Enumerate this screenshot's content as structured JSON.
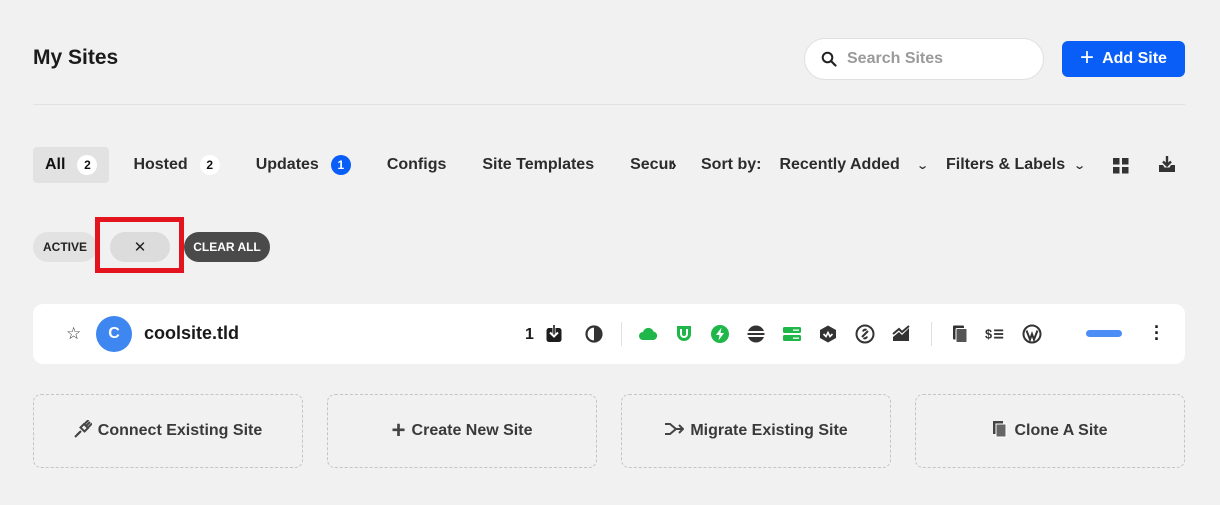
{
  "header": {
    "title": "My Sites",
    "search_placeholder": "Search Sites",
    "add_site_label": "Add Site",
    "add_site_icon": "plus-icon"
  },
  "tabs": [
    {
      "label": "All",
      "count": "2",
      "active": true
    },
    {
      "label": "Hosted",
      "count": "2"
    },
    {
      "label": "Updates",
      "count": "1",
      "badge_color": "#0a5ef8"
    },
    {
      "label": "Configs"
    },
    {
      "label": "Site Templates"
    },
    {
      "label": "Securi"
    }
  ],
  "toolbar": {
    "sort_label": "Sort by:",
    "sort_value": "Recently Added",
    "filters_label": "Filters & Labels"
  },
  "chips": {
    "active_label": "ACTIVE",
    "remove_symbol": "✕",
    "clear_all_label": "CLEAR ALL"
  },
  "sites": [
    {
      "avatar_letter": "C",
      "name": "coolsite.tld",
      "updates_count": "1",
      "progress_color": "#4c8ef5",
      "icons": [
        "download-icon",
        "backup-icon",
        "cloud-icon",
        "shield-icon",
        "bolt-icon",
        "database-icon",
        "server-icon",
        "cube-icon",
        "link-icon",
        "analytics-icon",
        "copy-icon",
        "billing-icon",
        "wordpress-icon"
      ]
    }
  ],
  "actions": [
    {
      "label": "Connect Existing Site",
      "icon": "plug-icon"
    },
    {
      "label": "Create New Site",
      "icon": "plus-icon"
    },
    {
      "label": "Migrate Existing Site",
      "icon": "migrate-icon"
    },
    {
      "label": "Clone A Site",
      "icon": "clone-icon"
    }
  ],
  "colors": {
    "accent": "#0a5ef8",
    "highlight": "#e3141e",
    "tool_green": "#1fb64a"
  }
}
